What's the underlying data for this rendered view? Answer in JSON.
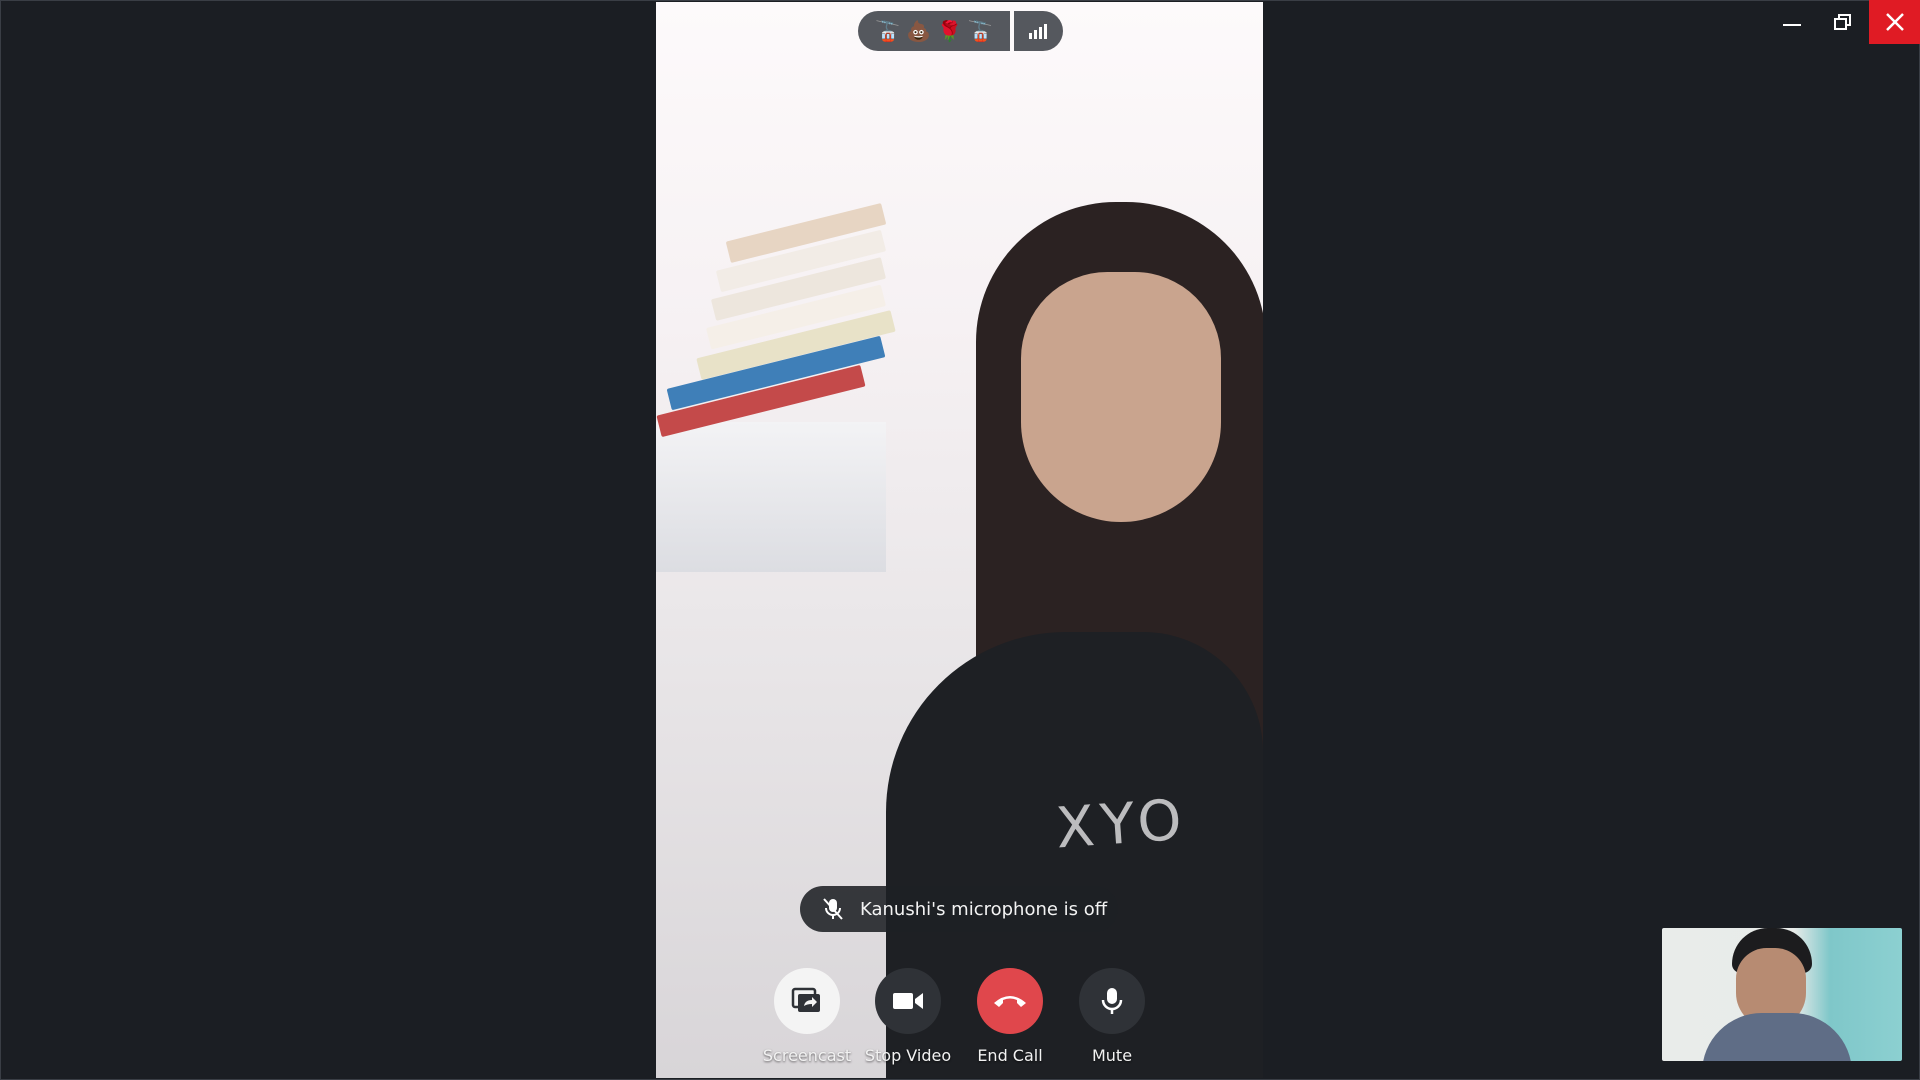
{
  "window": {
    "controls": [
      "minimize-icon",
      "restore-icon",
      "close-icon"
    ]
  },
  "call_status": {
    "emojis": [
      "🚡",
      "💩",
      "🌹",
      "🚡"
    ],
    "signal_icon": "signal-bars-icon"
  },
  "notification": {
    "text": "Kanushi's microphone is off",
    "icon": "microphone-off-icon"
  },
  "controls": {
    "screencast_label": "Screencast",
    "stop_video_label": "Stop Video",
    "end_call_label": "End Call",
    "mute_label": "Mute"
  },
  "colors": {
    "end_call": "#e0474c",
    "close_button": "#e01b24",
    "background": "#1b1e23"
  }
}
